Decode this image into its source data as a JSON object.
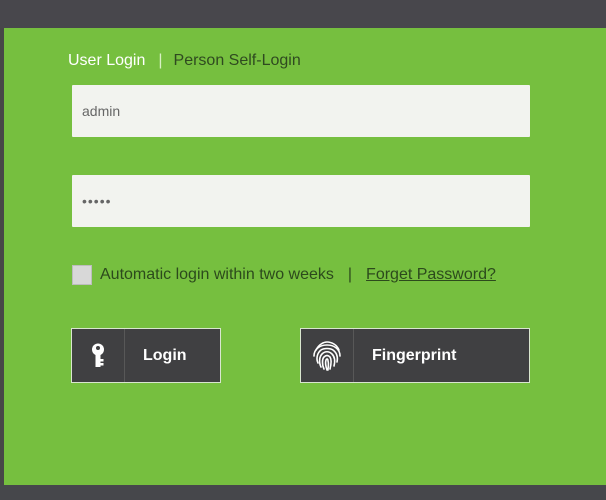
{
  "tabs": {
    "user_login": "User Login",
    "separator": "|",
    "person_self_login": "Person Self-Login"
  },
  "form": {
    "username_value": "admin",
    "password_value": "•••••",
    "remember_label": "Automatic login within two weeks",
    "separator": "|",
    "forget_password": "Forget Password?",
    "remember_checked": false
  },
  "buttons": {
    "login_label": "Login",
    "login_icon": "key-icon",
    "fingerprint_label": "Fingerprint",
    "fingerprint_icon": "fingerprint-icon"
  },
  "colors": {
    "panel_green": "#76bf3f",
    "dark_bar": "#48474c",
    "button_bg": "#404042"
  }
}
